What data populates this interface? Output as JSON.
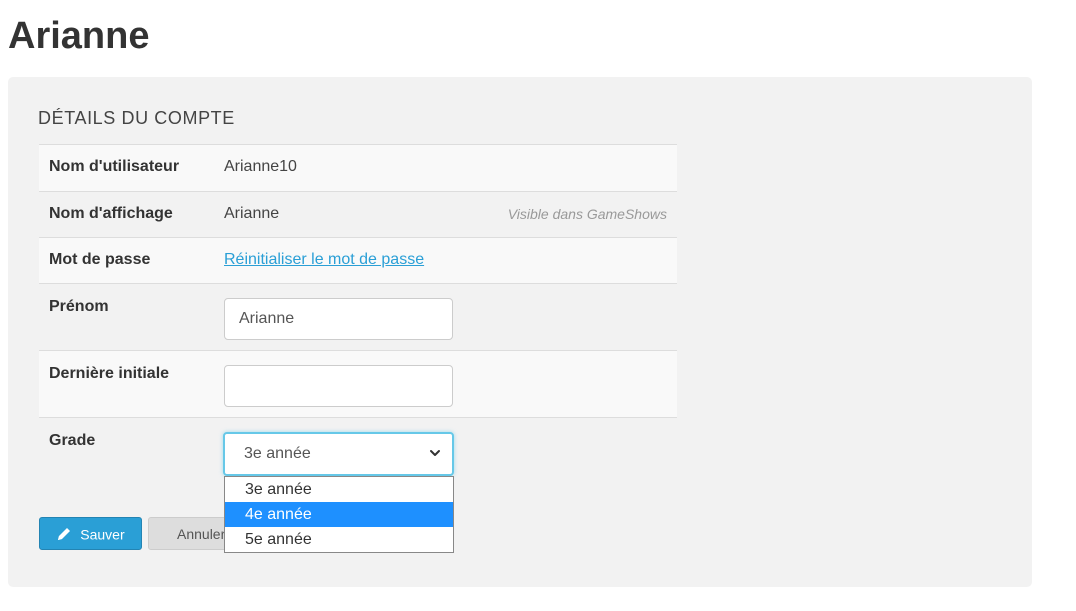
{
  "page": {
    "title": "Arianne"
  },
  "account": {
    "heading": "DÉTAILS DU COMPTE",
    "username": {
      "label": "Nom d'utilisateur",
      "value": "Arianne10"
    },
    "display_name": {
      "label": "Nom d'affichage",
      "value": "Arianne",
      "note": "Visible dans GameShows"
    },
    "password": {
      "label": "Mot de passe",
      "link": "Réinitialiser le mot de passe"
    },
    "first_name": {
      "label": "Prénom",
      "value": "Arianne"
    },
    "last_initial": {
      "label": "Dernière initiale",
      "value": ""
    },
    "grade": {
      "label": "Grade",
      "selected": "3e année",
      "options": [
        "3e année",
        "4e année",
        "5e année"
      ],
      "highlighted": "4e année"
    }
  },
  "actions": {
    "save_label": "Sauver",
    "cancel_label": "Annuler"
  },
  "colors": {
    "accent": "#2a9fd6",
    "panel_background": "#f2f2f2",
    "dropdown_highlight": "#1e90ff",
    "focus_border": "#66c8e8"
  },
  "icons": {
    "save": "pencil-icon",
    "select": "chevron-down-icon"
  }
}
